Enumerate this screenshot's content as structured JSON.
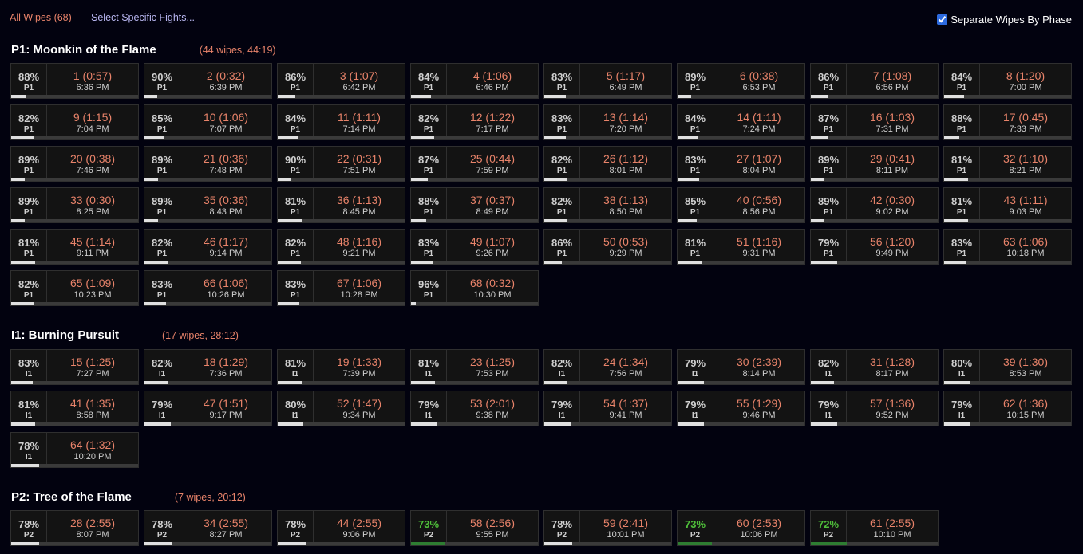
{
  "header": {
    "all_wipes_label": "All Wipes (68)",
    "select_label": "Select Specific Fights...",
    "separate_label": "Separate Wipes By Phase",
    "separate_checked": true
  },
  "colors": {
    "accent": "#e8836a",
    "link": "#b8b6f0",
    "green": "#4fbf3a",
    "bar_green": "#2e7d32"
  },
  "sections": [
    {
      "title": "P1: Moonkin of the Flame",
      "meta": "(44 wipes, 44:19)",
      "fights": [
        {
          "pct": "88%",
          "phase": "P1",
          "title": "1 (0:57)",
          "time": "6:36 PM",
          "progress": 0.12
        },
        {
          "pct": "90%",
          "phase": "P1",
          "title": "2 (0:32)",
          "time": "6:39 PM",
          "progress": 0.1
        },
        {
          "pct": "86%",
          "phase": "P1",
          "title": "3 (1:07)",
          "time": "6:42 PM",
          "progress": 0.14
        },
        {
          "pct": "84%",
          "phase": "P1",
          "title": "4 (1:06)",
          "time": "6:46 PM",
          "progress": 0.16
        },
        {
          "pct": "83%",
          "phase": "P1",
          "title": "5 (1:17)",
          "time": "6:49 PM",
          "progress": 0.17
        },
        {
          "pct": "89%",
          "phase": "P1",
          "title": "6 (0:38)",
          "time": "6:53 PM",
          "progress": 0.11
        },
        {
          "pct": "86%",
          "phase": "P1",
          "title": "7 (1:08)",
          "time": "6:56 PM",
          "progress": 0.14
        },
        {
          "pct": "84%",
          "phase": "P1",
          "title": "8 (1:20)",
          "time": "7:00 PM",
          "progress": 0.16
        },
        {
          "pct": "82%",
          "phase": "P1",
          "title": "9 (1:15)",
          "time": "7:04 PM",
          "progress": 0.18
        },
        {
          "pct": "85%",
          "phase": "P1",
          "title": "10 (1:06)",
          "time": "7:07 PM",
          "progress": 0.15
        },
        {
          "pct": "84%",
          "phase": "P1",
          "title": "11 (1:11)",
          "time": "7:14 PM",
          "progress": 0.16
        },
        {
          "pct": "82%",
          "phase": "P1",
          "title": "12 (1:22)",
          "time": "7:17 PM",
          "progress": 0.18
        },
        {
          "pct": "83%",
          "phase": "P1",
          "title": "13 (1:14)",
          "time": "7:20 PM",
          "progress": 0.17
        },
        {
          "pct": "84%",
          "phase": "P1",
          "title": "14 (1:11)",
          "time": "7:24 PM",
          "progress": 0.16
        },
        {
          "pct": "87%",
          "phase": "P1",
          "title": "16 (1:03)",
          "time": "7:31 PM",
          "progress": 0.13
        },
        {
          "pct": "88%",
          "phase": "P1",
          "title": "17 (0:45)",
          "time": "7:33 PM",
          "progress": 0.12
        },
        {
          "pct": "89%",
          "phase": "P1",
          "title": "20 (0:38)",
          "time": "7:46 PM",
          "progress": 0.11
        },
        {
          "pct": "89%",
          "phase": "P1",
          "title": "21 (0:36)",
          "time": "7:48 PM",
          "progress": 0.11
        },
        {
          "pct": "90%",
          "phase": "P1",
          "title": "22 (0:31)",
          "time": "7:51 PM",
          "progress": 0.1
        },
        {
          "pct": "87%",
          "phase": "P1",
          "title": "25 (0:44)",
          "time": "7:59 PM",
          "progress": 0.13
        },
        {
          "pct": "82%",
          "phase": "P1",
          "title": "26 (1:12)",
          "time": "8:01 PM",
          "progress": 0.18
        },
        {
          "pct": "83%",
          "phase": "P1",
          "title": "27 (1:07)",
          "time": "8:04 PM",
          "progress": 0.17
        },
        {
          "pct": "89%",
          "phase": "P1",
          "title": "29 (0:41)",
          "time": "8:11 PM",
          "progress": 0.11
        },
        {
          "pct": "81%",
          "phase": "P1",
          "title": "32 (1:10)",
          "time": "8:21 PM",
          "progress": 0.19
        },
        {
          "pct": "89%",
          "phase": "P1",
          "title": "33 (0:30)",
          "time": "8:25 PM",
          "progress": 0.11
        },
        {
          "pct": "89%",
          "phase": "P1",
          "title": "35 (0:36)",
          "time": "8:43 PM",
          "progress": 0.11
        },
        {
          "pct": "81%",
          "phase": "P1",
          "title": "36 (1:13)",
          "time": "8:45 PM",
          "progress": 0.19
        },
        {
          "pct": "88%",
          "phase": "P1",
          "title": "37 (0:37)",
          "time": "8:49 PM",
          "progress": 0.12
        },
        {
          "pct": "82%",
          "phase": "P1",
          "title": "38 (1:13)",
          "time": "8:50 PM",
          "progress": 0.18
        },
        {
          "pct": "85%",
          "phase": "P1",
          "title": "40 (0:56)",
          "time": "8:56 PM",
          "progress": 0.15
        },
        {
          "pct": "89%",
          "phase": "P1",
          "title": "42 (0:30)",
          "time": "9:02 PM",
          "progress": 0.11
        },
        {
          "pct": "81%",
          "phase": "P1",
          "title": "43 (1:11)",
          "time": "9:03 PM",
          "progress": 0.19
        },
        {
          "pct": "81%",
          "phase": "P1",
          "title": "45 (1:14)",
          "time": "9:11 PM",
          "progress": 0.19
        },
        {
          "pct": "82%",
          "phase": "P1",
          "title": "46 (1:17)",
          "time": "9:14 PM",
          "progress": 0.18
        },
        {
          "pct": "82%",
          "phase": "P1",
          "title": "48 (1:16)",
          "time": "9:21 PM",
          "progress": 0.18
        },
        {
          "pct": "83%",
          "phase": "P1",
          "title": "49 (1:07)",
          "time": "9:26 PM",
          "progress": 0.17
        },
        {
          "pct": "86%",
          "phase": "P1",
          "title": "50 (0:53)",
          "time": "9:29 PM",
          "progress": 0.14
        },
        {
          "pct": "81%",
          "phase": "P1",
          "title": "51 (1:16)",
          "time": "9:31 PM",
          "progress": 0.19
        },
        {
          "pct": "79%",
          "phase": "P1",
          "title": "56 (1:20)",
          "time": "9:49 PM",
          "progress": 0.21
        },
        {
          "pct": "83%",
          "phase": "P1",
          "title": "63 (1:06)",
          "time": "10:18 PM",
          "progress": 0.17
        },
        {
          "pct": "82%",
          "phase": "P1",
          "title": "65 (1:09)",
          "time": "10:23 PM",
          "progress": 0.18
        },
        {
          "pct": "83%",
          "phase": "P1",
          "title": "66 (1:06)",
          "time": "10:26 PM",
          "progress": 0.17
        },
        {
          "pct": "83%",
          "phase": "P1",
          "title": "67 (1:06)",
          "time": "10:28 PM",
          "progress": 0.17
        },
        {
          "pct": "96%",
          "phase": "P1",
          "title": "68 (0:32)",
          "time": "10:30 PM",
          "progress": 0.04
        }
      ]
    },
    {
      "title": "I1: Burning Pursuit",
      "meta": "(17 wipes, 28:12)",
      "fights": [
        {
          "pct": "83%",
          "phase": "I1",
          "title": "15 (1:25)",
          "time": "7:27 PM",
          "progress": 0.17
        },
        {
          "pct": "82%",
          "phase": "I1",
          "title": "18 (1:29)",
          "time": "7:36 PM",
          "progress": 0.18
        },
        {
          "pct": "81%",
          "phase": "I1",
          "title": "19 (1:33)",
          "time": "7:39 PM",
          "progress": 0.19
        },
        {
          "pct": "81%",
          "phase": "I1",
          "title": "23 (1:25)",
          "time": "7:53 PM",
          "progress": 0.19
        },
        {
          "pct": "82%",
          "phase": "I1",
          "title": "24 (1:34)",
          "time": "7:56 PM",
          "progress": 0.18
        },
        {
          "pct": "79%",
          "phase": "I1",
          "title": "30 (2:39)",
          "time": "8:14 PM",
          "progress": 0.21
        },
        {
          "pct": "82%",
          "phase": "I1",
          "title": "31 (1:28)",
          "time": "8:17 PM",
          "progress": 0.18
        },
        {
          "pct": "80%",
          "phase": "I1",
          "title": "39 (1:30)",
          "time": "8:53 PM",
          "progress": 0.2
        },
        {
          "pct": "81%",
          "phase": "I1",
          "title": "41 (1:35)",
          "time": "8:58 PM",
          "progress": 0.19
        },
        {
          "pct": "79%",
          "phase": "I1",
          "title": "47 (1:51)",
          "time": "9:17 PM",
          "progress": 0.21
        },
        {
          "pct": "80%",
          "phase": "I1",
          "title": "52 (1:47)",
          "time": "9:34 PM",
          "progress": 0.2
        },
        {
          "pct": "79%",
          "phase": "I1",
          "title": "53 (2:01)",
          "time": "9:38 PM",
          "progress": 0.21
        },
        {
          "pct": "79%",
          "phase": "I1",
          "title": "54 (1:37)",
          "time": "9:41 PM",
          "progress": 0.21
        },
        {
          "pct": "79%",
          "phase": "I1",
          "title": "55 (1:29)",
          "time": "9:46 PM",
          "progress": 0.21
        },
        {
          "pct": "79%",
          "phase": "I1",
          "title": "57 (1:36)",
          "time": "9:52 PM",
          "progress": 0.21
        },
        {
          "pct": "79%",
          "phase": "I1",
          "title": "62 (1:36)",
          "time": "10:15 PM",
          "progress": 0.21
        },
        {
          "pct": "78%",
          "phase": "I1",
          "title": "64 (1:32)",
          "time": "10:20 PM",
          "progress": 0.22
        }
      ]
    },
    {
      "title": "P2: Tree of the Flame",
      "meta": "(7 wipes, 20:12)",
      "fights": [
        {
          "pct": "78%",
          "phase": "P2",
          "title": "28 (2:55)",
          "time": "8:07 PM",
          "progress": 0.22
        },
        {
          "pct": "78%",
          "phase": "P2",
          "title": "34 (2:55)",
          "time": "8:27 PM",
          "progress": 0.22
        },
        {
          "pct": "78%",
          "phase": "P2",
          "title": "44 (2:55)",
          "time": "9:06 PM",
          "progress": 0.22
        },
        {
          "pct": "73%",
          "phase": "P2",
          "title": "58 (2:56)",
          "time": "9:55 PM",
          "progress": 0.27,
          "green": true
        },
        {
          "pct": "78%",
          "phase": "P2",
          "title": "59 (2:41)",
          "time": "10:01 PM",
          "progress": 0.22
        },
        {
          "pct": "73%",
          "phase": "P2",
          "title": "60 (2:53)",
          "time": "10:06 PM",
          "progress": 0.27,
          "green": true
        },
        {
          "pct": "72%",
          "phase": "P2",
          "title": "61 (2:55)",
          "time": "10:10 PM",
          "progress": 0.28,
          "green": true
        }
      ]
    }
  ]
}
